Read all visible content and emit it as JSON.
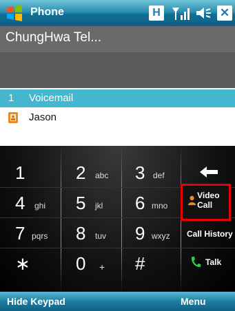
{
  "app": {
    "title": "Phone"
  },
  "status": {
    "h_label": "H"
  },
  "carrier": {
    "name": "ChungHwa Tel..."
  },
  "list": [
    {
      "num": "1",
      "label": "Voicemail"
    },
    {
      "label": "Jason"
    }
  ],
  "keypad": {
    "keys": [
      {
        "digit": "1",
        "letters": ""
      },
      {
        "digit": "2",
        "letters": "abc"
      },
      {
        "digit": "3",
        "letters": "def"
      },
      {
        "digit": "4",
        "letters": "ghi"
      },
      {
        "digit": "5",
        "letters": "jkl"
      },
      {
        "digit": "6",
        "letters": "mno"
      },
      {
        "digit": "7",
        "letters": "pqrs"
      },
      {
        "digit": "8",
        "letters": "tuv"
      },
      {
        "digit": "9",
        "letters": "wxyz"
      },
      {
        "digit": "∗",
        "letters": ""
      },
      {
        "digit": "0",
        "letters": "+"
      },
      {
        "digit": "#",
        "letters": ""
      }
    ],
    "side": {
      "video_call": "Video Call",
      "call_history": "Call History",
      "talk": "Talk"
    }
  },
  "softkeys": {
    "left": "Hide Keypad",
    "right": "Menu"
  },
  "colors": {
    "highlight": "#44b7cf",
    "focus_border": "#e60000",
    "talk_green": "#2ecc40"
  }
}
